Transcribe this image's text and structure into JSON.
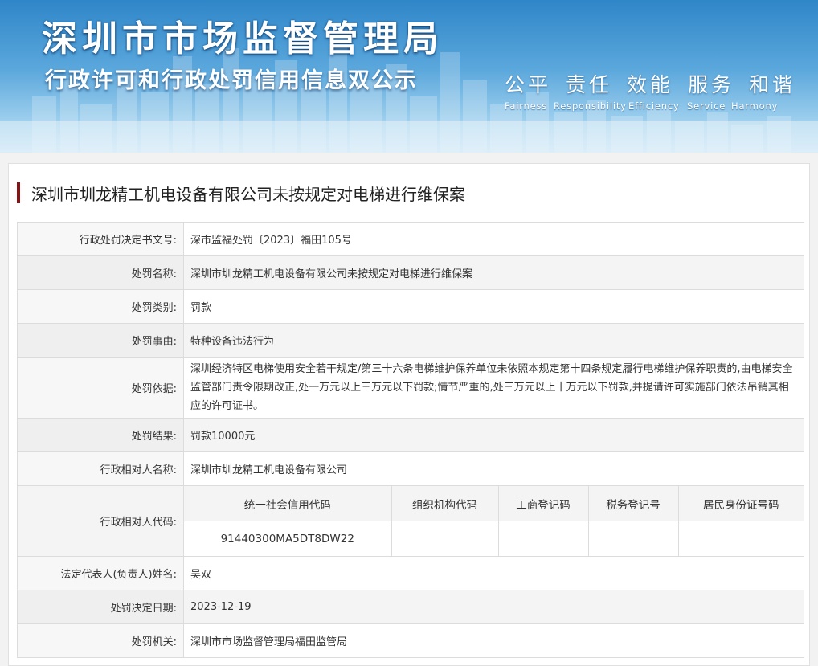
{
  "banner": {
    "title": "深圳市市场监督管理局",
    "subtitle": "行政许可和行政处罚信用信息双公示",
    "motto_cn": [
      "公平",
      "责任",
      "效能",
      "服务",
      "和谐"
    ],
    "motto_en": [
      "Fairness",
      "Responsibility",
      "Efficiency",
      "Service",
      "Harmony"
    ]
  },
  "case": {
    "title": "深圳市圳龙精工机电设备有限公司未按规定对电梯进行维保案"
  },
  "fields": {
    "doc_no": {
      "label": "行政处罚决定书文号:",
      "value": "深市监福处罚〔2023〕福田105号"
    },
    "name": {
      "label": "处罚名称:",
      "value": "深圳市圳龙精工机电设备有限公司未按规定对电梯进行维保案"
    },
    "category": {
      "label": "处罚类别:",
      "value": "罚款"
    },
    "reason": {
      "label": "处罚事由:",
      "value": "特种设备违法行为"
    },
    "basis": {
      "label": "处罚依据:",
      "value": "深圳经济特区电梯使用安全若干规定/第三十六条电梯维护保养单位未依照本规定第十四条规定履行电梯维护保养职责的,由电梯安全监管部门责令限期改正,处一万元以上三万元以下罚款;情节严重的,处三万元以上十万元以下罚款,并提请许可实施部门依法吊销其相应的许可证书。"
    },
    "result": {
      "label": "处罚结果:",
      "value": "罚款10000元"
    },
    "party_name": {
      "label": "行政相对人名称:",
      "value": "深圳市圳龙精工机电设备有限公司"
    },
    "party_code": {
      "label": "行政相对人代码:",
      "headers": [
        "统一社会信用代码",
        "组织机构代码",
        "工商登记码",
        "税务登记号",
        "居民身份证号码"
      ],
      "values": [
        "91440300MA5DT8DW22",
        "",
        "",
        "",
        ""
      ]
    },
    "legal_rep": {
      "label": "法定代表人(负责人)姓名:",
      "value": "吴双"
    },
    "decision_date": {
      "label": "处罚决定日期:",
      "value": "2023-12-19"
    },
    "authority": {
      "label": "处罚机关:",
      "value": "深圳市市场监督管理局福田监管局"
    }
  },
  "colors": {
    "title_accent": "#8b1212",
    "banner_blue": "#2f86c8"
  }
}
